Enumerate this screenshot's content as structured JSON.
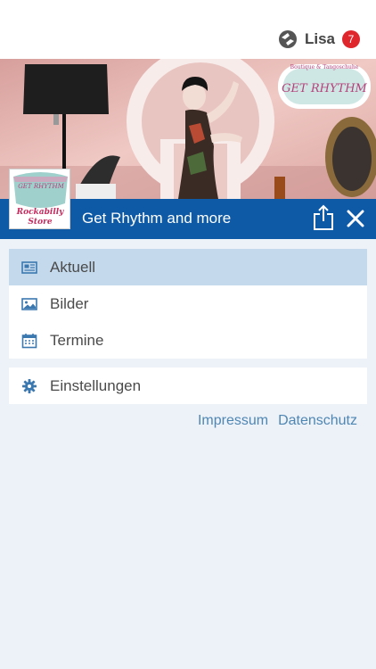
{
  "user": {
    "name": "Lisa",
    "badge_count": "7"
  },
  "header": {
    "title": "Get Rhythm and more"
  },
  "banner": {
    "sign_small": "Boutique & Tangoschuhe",
    "sign_main": "GET RHYTHM"
  },
  "store_logo": {
    "brand": "GET RHYTHM",
    "line1": "Rockabilly",
    "line2": "Store"
  },
  "menu": {
    "items": [
      {
        "label": "Aktuell",
        "icon": "newspaper-icon",
        "active": true
      },
      {
        "label": "Bilder",
        "icon": "image-icon",
        "active": false
      },
      {
        "label": "Termine",
        "icon": "calendar-icon",
        "active": false
      }
    ],
    "settings": {
      "label": "Einstellungen",
      "icon": "gear-icon"
    }
  },
  "footer": {
    "impressum": "Impressum",
    "datenschutz": "Datenschutz"
  },
  "colors": {
    "brand_blue": "#0e5aa7",
    "active_row": "#c4d9ec",
    "badge_red": "#e0262d",
    "link": "#4f87b3",
    "background": "#edf1f8"
  }
}
